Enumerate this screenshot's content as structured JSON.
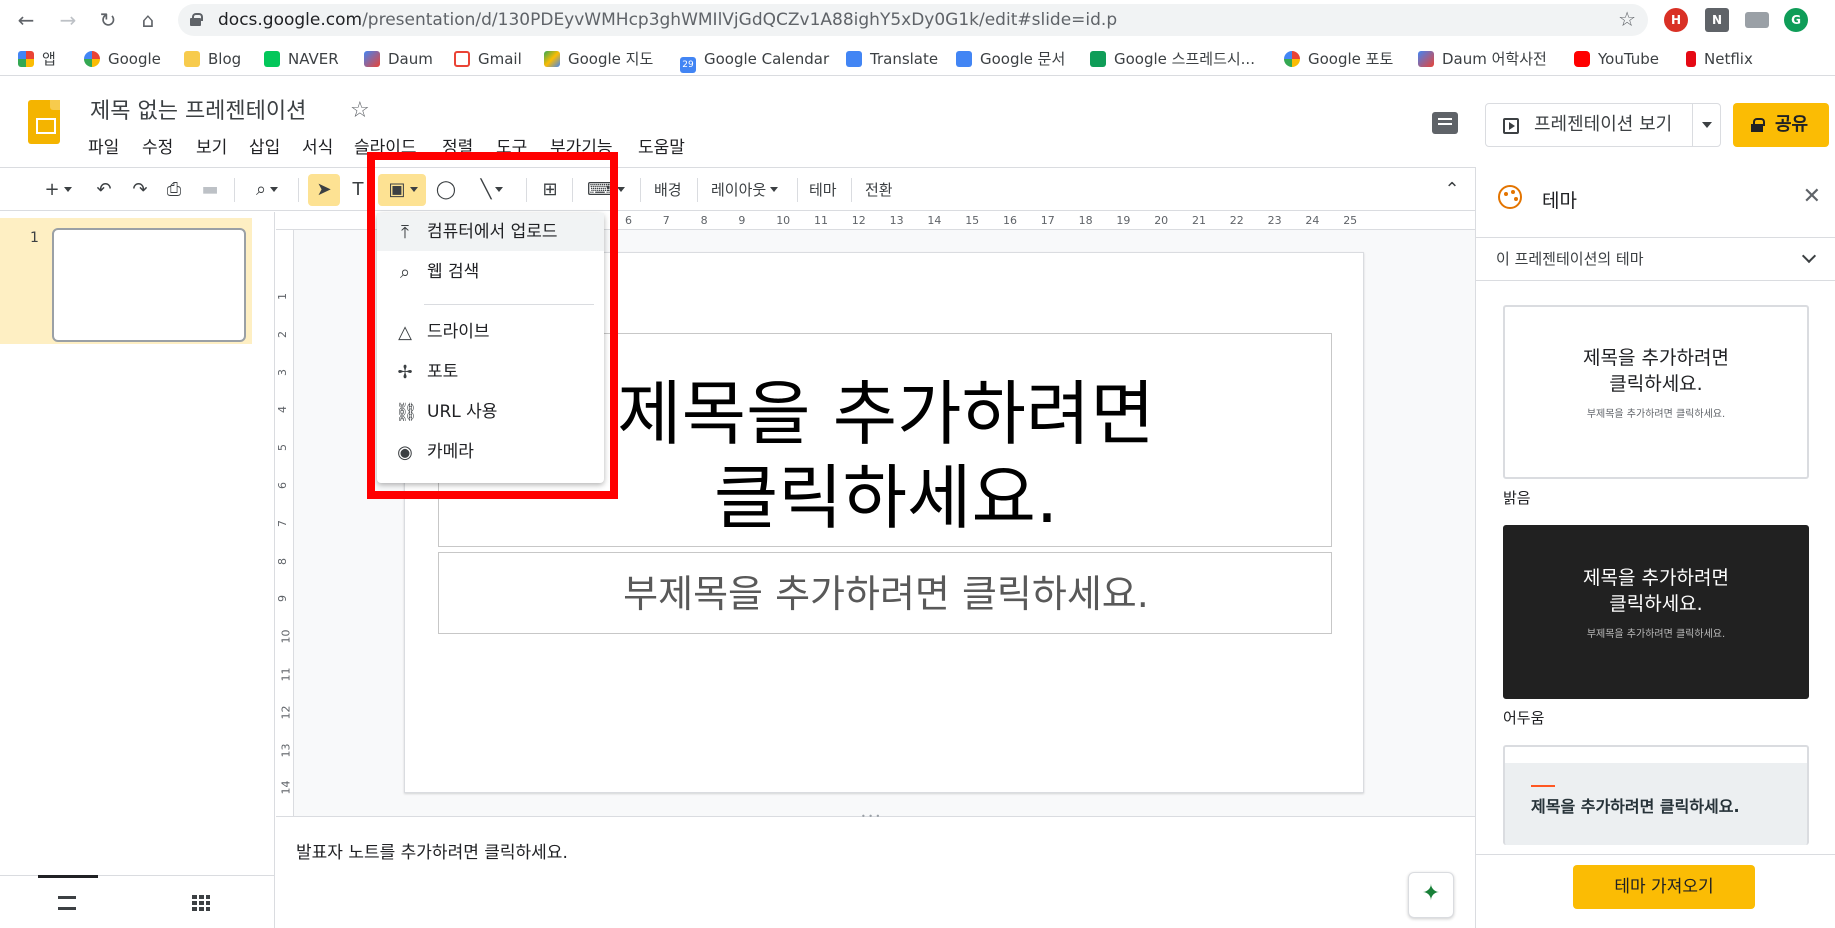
{
  "browser": {
    "url_host": "docs.google.com",
    "url_path": "/presentation/d/130PDEyvWMHcp3ghWMIlVjGdQCZv1A88ighY5xDy0G1k/edit#slide=id.p",
    "bookmarks": [
      "앱",
      "Google",
      "Blog",
      "NAVER",
      "Daum",
      "Gmail",
      "Google 지도",
      "Google Calendar",
      "Translate",
      "Google 문서",
      "Google 스프레드시...",
      "Google 포토",
      "Daum 어학사전",
      "YouTube",
      "Netflix"
    ],
    "calendar_day": "29"
  },
  "doc": {
    "title": "제목 없는 프레젠테이션",
    "menu": [
      "파일",
      "수정",
      "보기",
      "삽입",
      "서식",
      "슬라이드",
      "정렬",
      "도구",
      "부가기능",
      "도움말"
    ],
    "present_label": "프레젠테이션 보기",
    "share_label": "공유"
  },
  "toolbar": {
    "background": "배경",
    "layout": "레이아웃",
    "theme": "테마",
    "transition": "전환"
  },
  "filmstrip": {
    "slide_number": "1"
  },
  "ruler": {
    "top": [
      "6",
      "7",
      "8",
      "9",
      "10",
      "11",
      "12",
      "13",
      "14",
      "15",
      "16",
      "17",
      "18",
      "19",
      "20",
      "21",
      "22",
      "23",
      "24",
      "25"
    ],
    "left": [
      "1",
      "2",
      "3",
      "4",
      "5",
      "6",
      "7",
      "8",
      "9",
      "10",
      "11",
      "12",
      "13",
      "14"
    ]
  },
  "slide": {
    "title_line1": "제목을 추가하려면",
    "title_line2": "클릭하세요.",
    "subtitle": "부제목을 추가하려면 클릭하세요."
  },
  "notes": {
    "placeholder": "발표자 노트를 추가하려면 클릭하세요."
  },
  "theme_panel": {
    "title": "테마",
    "section": "이 프레젠테이션의 테마",
    "card_title_line1": "제목을 추가하려면",
    "card_title_line2": "클릭하세요.",
    "card_subtitle": "부제목을 추가하려면 클릭하세요.",
    "card3_title": "제목을 추가하려면 클릭하세요.",
    "themes": [
      "밝음",
      "어두움"
    ],
    "import_label": "테마 가져오기"
  },
  "image_menu": {
    "items": [
      "컴퓨터에서 업로드",
      "웹 검색",
      "드라이브",
      "포토",
      "URL 사용",
      "카메라"
    ]
  },
  "colors": {
    "accent_yellow": "#fbbc04",
    "selection": "#feefc3",
    "highlight": "#ff0000"
  }
}
